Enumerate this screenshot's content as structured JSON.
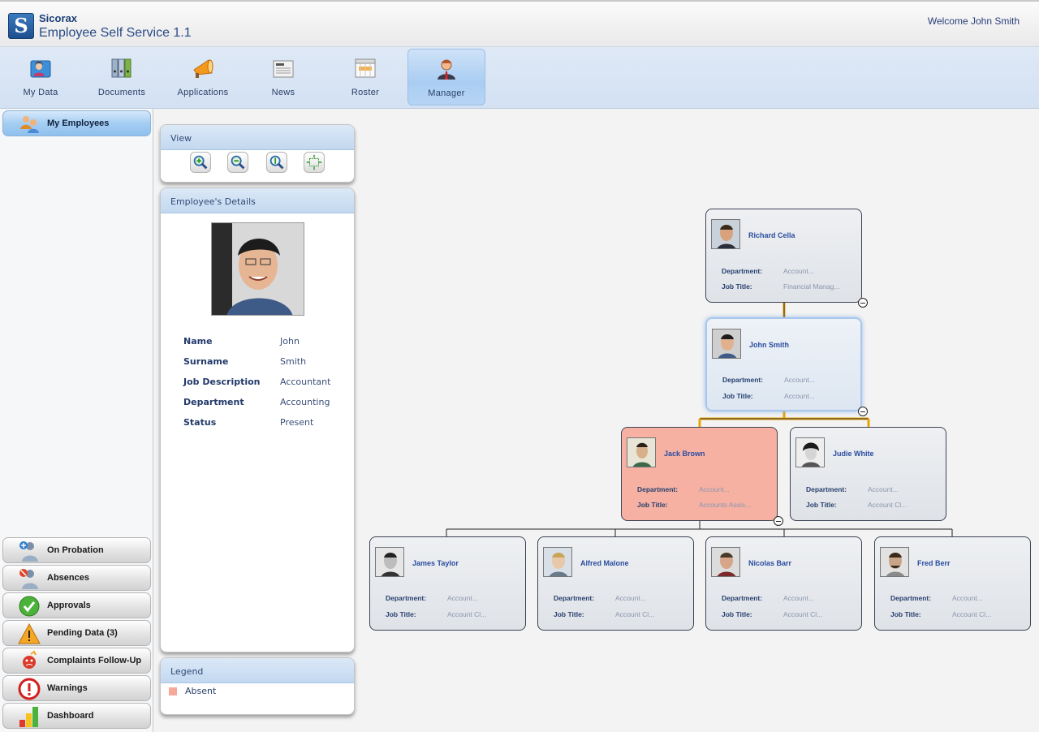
{
  "header": {
    "logo_letter": "S",
    "company": "Sicorax",
    "app_title": "Employee Self Service 1.1",
    "welcome": "Welcome John Smith"
  },
  "nav": {
    "items": [
      {
        "label": "My Data",
        "icon": "person-card-icon"
      },
      {
        "label": "Documents",
        "icon": "binders-icon"
      },
      {
        "label": "Applications",
        "icon": "megaphone-icon"
      },
      {
        "label": "News",
        "icon": "newspaper-icon"
      },
      {
        "label": "Roster",
        "icon": "calendar-grid-icon"
      },
      {
        "label": "Manager",
        "icon": "manager-icon",
        "active": true
      }
    ]
  },
  "sidebar": {
    "top": {
      "label": "My Employees",
      "icon": "employees-icon"
    },
    "bottom": [
      {
        "label": "On Probation",
        "icon": "probation-user-icon"
      },
      {
        "label": "Absences",
        "icon": "absent-user-icon"
      },
      {
        "label": "Approvals",
        "icon": "check-icon"
      },
      {
        "label": "Pending Data (3)",
        "icon": "warning-icon"
      },
      {
        "label": "Complaints Follow-Up",
        "icon": "complaint-icon"
      },
      {
        "label": "Warnings",
        "icon": "exclamation-icon"
      },
      {
        "label": "Dashboard",
        "icon": "bar-chart-icon"
      }
    ]
  },
  "view_panel": {
    "title": "View",
    "tools": [
      "zoom-in-icon",
      "zoom-out-icon",
      "zoom-reset-icon",
      "fit-to-screen-icon"
    ]
  },
  "details_panel": {
    "title": "Employee's Details",
    "rows": [
      {
        "label": "Name",
        "value": "John"
      },
      {
        "label": "Surname",
        "value": "Smith"
      },
      {
        "label": "Job Description",
        "value": "Accountant"
      },
      {
        "label": "Department",
        "value": "Accounting"
      },
      {
        "label": "Status",
        "value": "Present"
      }
    ]
  },
  "legend_panel": {
    "title": "Legend",
    "items": [
      {
        "label": "Absent",
        "color": "#f6a99a"
      }
    ]
  },
  "org": {
    "dept_label": "Department:",
    "title_label": "Job Title:",
    "nodes": [
      {
        "name": "Richard Cella",
        "department": "Account...",
        "job_title": "Financial Manag..."
      },
      {
        "name": "John Smith",
        "department": "Account...",
        "job_title": "Account...",
        "selected": true
      },
      {
        "name": "Jack Brown",
        "department": "Account...",
        "job_title": "Accounts Assis...",
        "absent": true
      },
      {
        "name": "Judie White",
        "department": "Account...",
        "job_title": "Account Cl..."
      },
      {
        "name": "James Taylor",
        "department": "Account...",
        "job_title": "Account Cl..."
      },
      {
        "name": "Alfred Malone",
        "department": "Account...",
        "job_title": "Account Cl..."
      },
      {
        "name": "Nicolas Barr",
        "department": "Account...",
        "job_title": "Account Cl..."
      },
      {
        "name": "Fred Berr",
        "department": "Account...",
        "job_title": "Account Cl..."
      }
    ]
  },
  "colors": {
    "absent": "#f6a99a",
    "accent_blue": "#2a4ca0",
    "connector_highlight": "#f0a500"
  }
}
